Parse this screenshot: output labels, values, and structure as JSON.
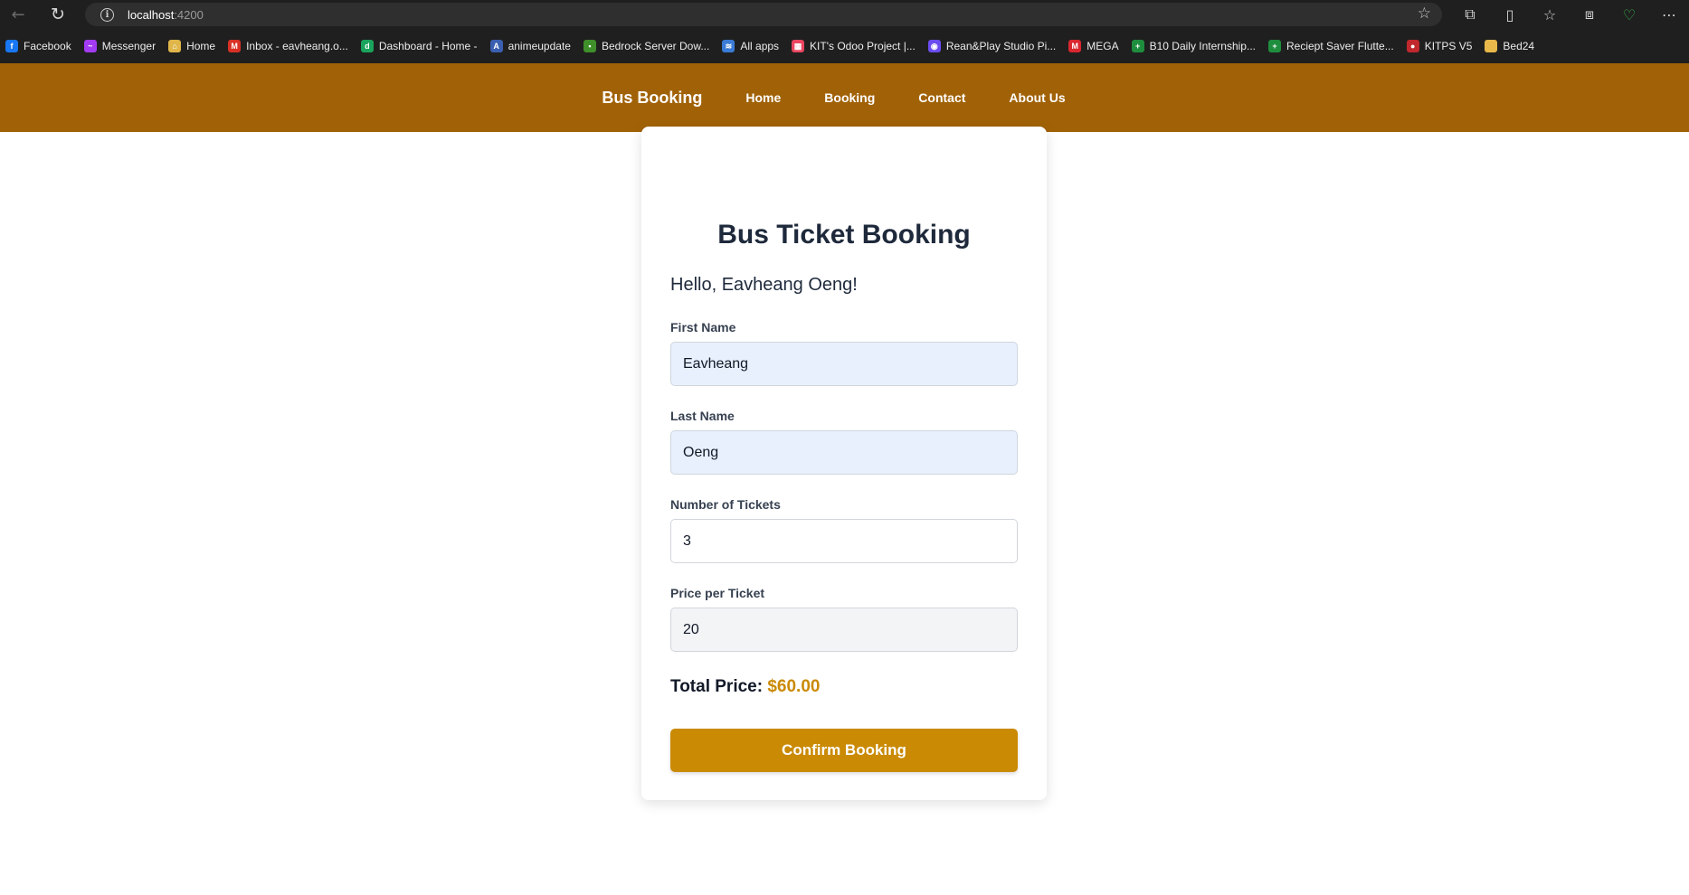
{
  "browser": {
    "url_host": "localhost",
    "url_port": ":4200",
    "bookmarks": [
      {
        "label": "Facebook",
        "icon": "facebook-icon",
        "color": "#1877f2",
        "glyph": "f"
      },
      {
        "label": "Messenger",
        "icon": "messenger-icon",
        "color": "#a33bf2",
        "glyph": "~"
      },
      {
        "label": "Home",
        "icon": "home-icon",
        "color": "#e0b64a",
        "glyph": "⌂"
      },
      {
        "label": "Inbox - eavheang.o...",
        "icon": "gmail-icon",
        "color": "#d93025",
        "glyph": "M"
      },
      {
        "label": "Dashboard - Home -",
        "icon": "dashboard-icon",
        "color": "#1aa35c",
        "glyph": "d"
      },
      {
        "label": "animeupdate",
        "icon": "anime-icon",
        "color": "#3b5fb0",
        "glyph": "A"
      },
      {
        "label": "Bedrock Server Dow...",
        "icon": "minecraft-icon",
        "color": "#3f8f2a",
        "glyph": "▪"
      },
      {
        "label": "All apps",
        "icon": "apps-icon",
        "color": "#3a7bd5",
        "glyph": "≋"
      },
      {
        "label": "KIT's Odoo Project |...",
        "icon": "odoo-icon",
        "color": "#e94560",
        "glyph": "▦"
      },
      {
        "label": "Rean&Play Studio Pi...",
        "icon": "studio-icon",
        "color": "#6a4cf0",
        "glyph": "◉"
      },
      {
        "label": "MEGA",
        "icon": "mega-icon",
        "color": "#d9272e",
        "glyph": "M"
      },
      {
        "label": "B10 Daily Internship...",
        "icon": "sheets-icon",
        "color": "#1e8e3e",
        "glyph": "+"
      },
      {
        "label": "Reciept Saver Flutte...",
        "icon": "sheets-icon",
        "color": "#1e8e3e",
        "glyph": "+"
      },
      {
        "label": "KITPS V5",
        "icon": "kitps-icon",
        "color": "#c0282d",
        "glyph": "●"
      },
      {
        "label": "Bed24",
        "icon": "folder-icon",
        "color": "#e8b84a",
        "glyph": ""
      }
    ]
  },
  "navbar": {
    "brand": "Bus Booking",
    "links": [
      "Home",
      "Booking",
      "Contact",
      "About Us"
    ]
  },
  "form": {
    "title": "Bus Ticket Booking",
    "greeting": "Hello, Eavheang Oeng!",
    "fields": [
      {
        "label": "First Name",
        "value": "Eavheang"
      },
      {
        "label": "Last Name",
        "value": "Oeng"
      },
      {
        "label": "Number of Tickets",
        "value": "3"
      },
      {
        "label": "Price per Ticket",
        "value": "20"
      }
    ],
    "total_label": "Total Price:",
    "total_value": "$60.00",
    "confirm_label": "Confirm Booking"
  },
  "colors": {
    "navbar": "#a16207",
    "accent": "#ca8a04",
    "autofill": "#e8f0fe"
  }
}
